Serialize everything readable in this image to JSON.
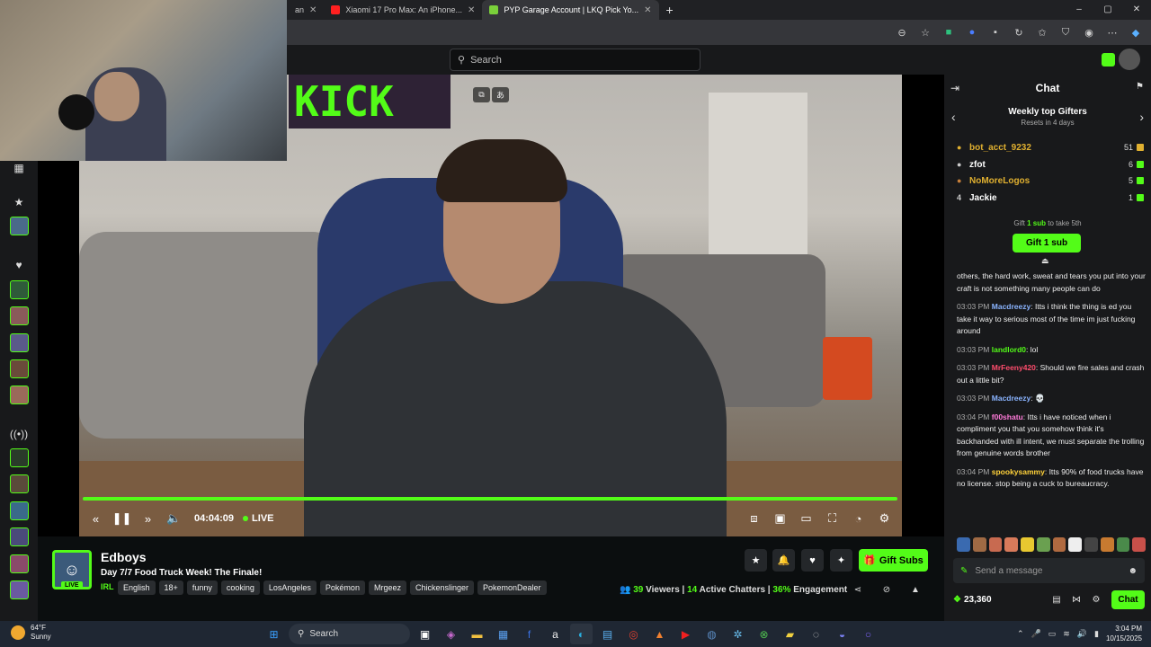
{
  "browser": {
    "tabs": [
      {
        "title": "an",
        "color": "#2f7bff"
      },
      {
        "title": "Xiaomi 17 Pro Max: An iPhone...",
        "color": "#ff2020"
      },
      {
        "title": "PYP Garage Account | LKQ Pick Yo...",
        "color": "#7ad03a"
      }
    ],
    "new_tab": "+",
    "window_controls": [
      "–",
      "▢",
      "✕"
    ]
  },
  "header": {
    "search_placeholder": "Search"
  },
  "player": {
    "timecode": "04:04:09",
    "live_label": "LIVE",
    "banner_text": "KICK"
  },
  "channel": {
    "name": "Edboys",
    "title": "Day 7/7 Food Truck Week! The Finale!",
    "live_tag": "LIVE",
    "category": "IRL",
    "tags": [
      "English",
      "18+",
      "funny",
      "cooking",
      "LosAngeles",
      "Pokémon",
      "Mrgeez",
      "Chickenslinger",
      "PokemonDealer"
    ],
    "gift_subs_label": "Gift Subs",
    "stats": {
      "viewers": "39",
      "viewers_label": "Viewers",
      "chatters": "14",
      "chatters_label": "Active Chatters",
      "engagement": "36%",
      "engagement_label": "Engagement"
    }
  },
  "chat": {
    "title": "Chat",
    "gifters_title": "Weekly top Gifters",
    "gifters_sub": "Resets in 4 days",
    "gifters": [
      {
        "rank": "●",
        "name": "bot_acct_9232",
        "count": "51",
        "color": "#e0b030"
      },
      {
        "rank": "●",
        "name": "zfot",
        "count": "6",
        "color": "#ffffff"
      },
      {
        "rank": "●",
        "name": "NoMoreLogos",
        "count": "5",
        "color": "#e0b030"
      },
      {
        "rank": "4",
        "name": "Jackie",
        "count": "1",
        "color": "#ffffff"
      }
    ],
    "gift_prompt_pre": "Gift",
    "gift_prompt_bold": "1 sub",
    "gift_prompt_post": "to take 5th",
    "gift_button": "Gift 1 sub",
    "messages": [
      {
        "time": "",
        "user": "",
        "user_color": "#ffffff",
        "text": "others, the hard work, sweat and tears you put into your craft is not something many people can do"
      },
      {
        "time": "03:03 PM",
        "user": "Macdreezy",
        "user_color": "#8ab4ff",
        "text": "Itts i think the thing is ed you take it way to serious most of the time im just fucking around"
      },
      {
        "time": "03:03 PM",
        "user": "landlord0",
        "user_color": "#53fc18",
        "text": "lol"
      },
      {
        "time": "03:03 PM",
        "user": "MrFeeny420",
        "user_color": "#ff4d6d",
        "text": "Should we fire sales and crash out a little bit?"
      },
      {
        "time": "03:03 PM",
        "user": "Macdreezy",
        "user_color": "#8ab4ff",
        "text": "💀"
      },
      {
        "time": "03:04 PM",
        "user": "f00shatu",
        "user_color": "#ff7ad9",
        "text": "Itts i have noticed when i compliment you that you somehow think it's backhanded with ill intent, we must separate the trolling from genuine words brother"
      },
      {
        "time": "03:04 PM",
        "user": "spookysammy",
        "user_color": "#ffd23a",
        "text": "Itts 90% of food trucks have no license. stop being a cuck to bureaucracy."
      }
    ],
    "input_placeholder": "Send a message",
    "points": "23,360",
    "send_label": "Chat"
  },
  "taskbar": {
    "temp": "64°F",
    "condition": "Sunny",
    "search_label": "Search",
    "time": "3:04 PM",
    "date": "10/15/2025"
  },
  "colors": {
    "accent": "#53fc18",
    "bg": "#0b0e0f",
    "panel": "#18191b"
  }
}
